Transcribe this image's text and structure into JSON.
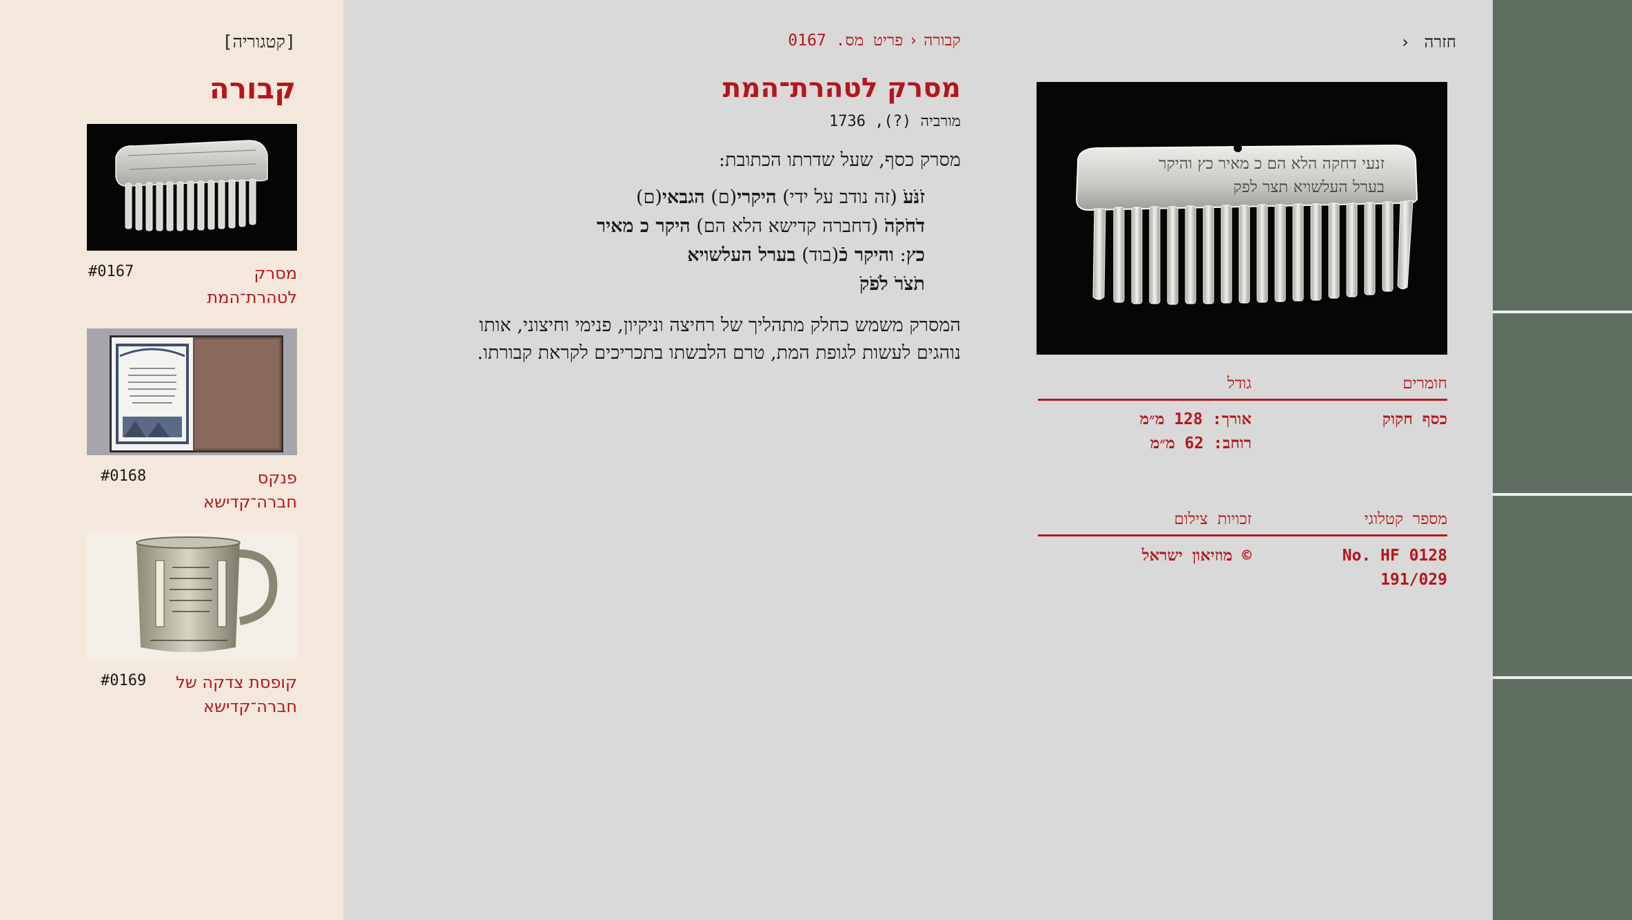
{
  "sidebar": {
    "category_tag": "[קטגוריה]",
    "category_title": "קבורה",
    "items": [
      {
        "name": "מסרק לטהרת־המת",
        "number": "#0167"
      },
      {
        "name": "פנקס חברה־קדישא",
        "number": "#0168"
      },
      {
        "name": "קופסת צדקה של חברה־קדישא",
        "number": "#0169"
      }
    ]
  },
  "header": {
    "back_label": "חזרה",
    "breadcrumb": {
      "category": "קבורה",
      "item": "פריט מס. 0167"
    }
  },
  "item": {
    "title": "מסרק לטהרת־המת",
    "origin": "מורביה (?), 1736",
    "intro": "מסרק כסף, שעל שדרתו הכתובת:",
    "inscription": [
      {
        "abbr": "זֹנֹּעֹ",
        "plain": " (זה נודב על ידי) ",
        "bold1": "היקרי",
        "plain2": "(ם) ",
        "bold2": "הגבאי",
        "plain3": "(ם)"
      },
      {
        "abbr": "דֹחֹקֹהֹ",
        "plain": " (דחברה קדישא הלא הם) ",
        "bold1": "היקר כ מאיר",
        "plain2": "",
        "bold2": "",
        "plain3": ""
      },
      {
        "abbr": "כץ",
        "plain": ": ",
        "bold1": "והיקר כֿ",
        "plain2": "(בוד) ",
        "bold2": "בערל העלשויא",
        "plain3": ""
      },
      {
        "abbr": "תֹצֹרֹ לֹפֹקֹ",
        "plain": "",
        "bold1": "",
        "plain2": "",
        "bold2": "",
        "plain3": ""
      }
    ],
    "description": "המסרק משמש כחלק מתהליך של רחיצה וניקיון, פנימי וחיצוני, אותו נוהגים לעשות לגופת המת, טרם הלבשתו בתכריכים לקראת קבורתו.",
    "image_inscription_line1": "זנעי דחקה הלא הם כ מאיר כץ והיקר",
    "image_inscription_line2": "בערל העלשויא תצר לפק"
  },
  "meta": {
    "materials_label": "חומרים",
    "materials_value": "כסף חקוק",
    "size_label": "גודל",
    "size_length": "אורך: 128 מ״מ",
    "size_width": "רוחב: 62 מ״מ",
    "catalog_label": "מספר קטלוגי",
    "catalog_line1": "No. HF 0128",
    "catalog_line2": "191/029",
    "rights_label": "זכויות צילום",
    "rights_value": "© מוזיאון ישראל"
  },
  "colors": {
    "accent": "#b5161c",
    "sidebar_bg": "#f4e8dd",
    "main_bg": "#d9d9d9",
    "rail_bg": "#5e6f61"
  },
  "icons": {
    "back": "chevron-left-icon",
    "breadcrumb_sep": "chevron-left-icon"
  }
}
